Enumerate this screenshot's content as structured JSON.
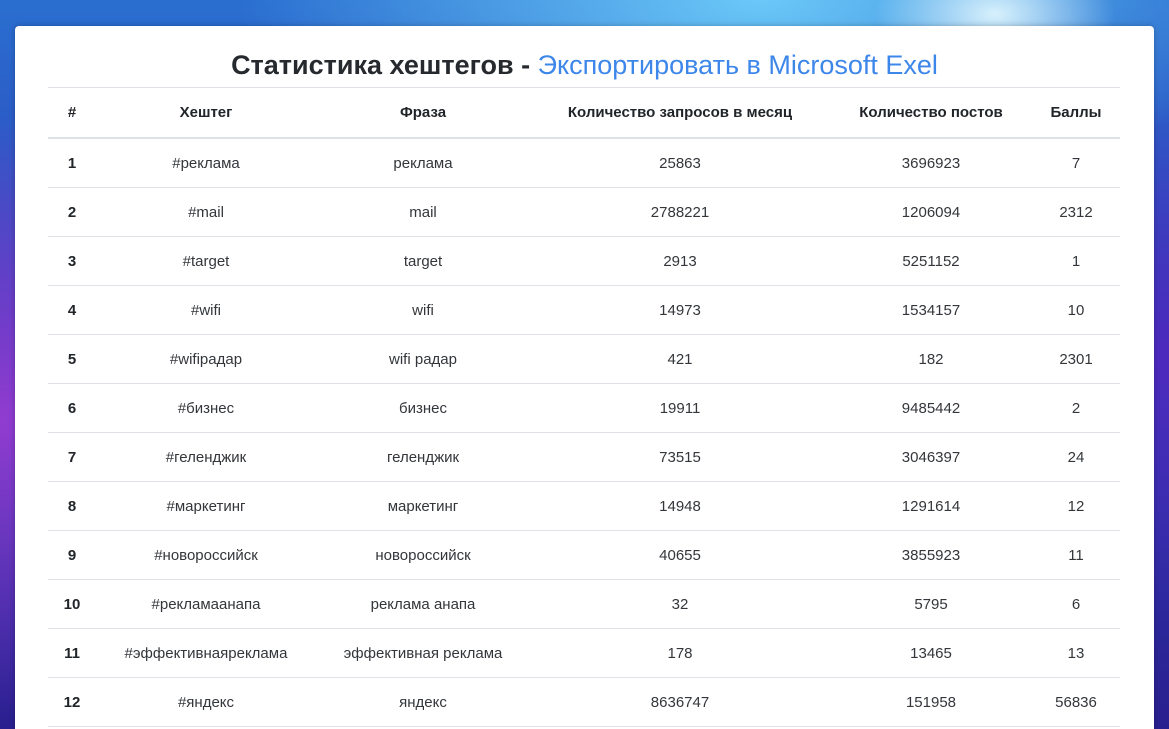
{
  "title": {
    "text": "Статистика хештегов - ",
    "export_link": "Экспортировать в Microsoft Exel"
  },
  "table": {
    "headers": [
      "#",
      "Хештег",
      "Фраза",
      "Количество запросов в месяц",
      "Количество постов",
      "Баллы"
    ],
    "rows": [
      [
        "1",
        "#реклама",
        "реклама",
        "25863",
        "3696923",
        "7"
      ],
      [
        "2",
        "#mail",
        "mail",
        "2788221",
        "1206094",
        "2312"
      ],
      [
        "3",
        "#target",
        "target",
        "2913",
        "5251152",
        "1"
      ],
      [
        "4",
        "#wifi",
        "wifi",
        "14973",
        "1534157",
        "10"
      ],
      [
        "5",
        "#wifiрадар",
        "wifi радар",
        "421",
        "182",
        "2301"
      ],
      [
        "6",
        "#бизнес",
        "бизнес",
        "19911",
        "9485442",
        "2"
      ],
      [
        "7",
        "#геленджик",
        "геленджик",
        "73515",
        "3046397",
        "24"
      ],
      [
        "8",
        "#маркетинг",
        "маркетинг",
        "14948",
        "1291614",
        "12"
      ],
      [
        "9",
        "#новороссийск",
        "новороссийск",
        "40655",
        "3855923",
        "11"
      ],
      [
        "10",
        "#рекламаанапа",
        "реклама анапа",
        "32",
        "5795",
        "6"
      ],
      [
        "11",
        "#эффективнаяреклама",
        "эффективная реклама",
        "178",
        "13465",
        "13"
      ],
      [
        "12",
        "#яндекс",
        "яндекс",
        "8636747",
        "151958",
        "56836"
      ]
    ]
  },
  "colors": {
    "link": "#3d87ea",
    "text": "#212529",
    "border": "#dee2e6"
  }
}
